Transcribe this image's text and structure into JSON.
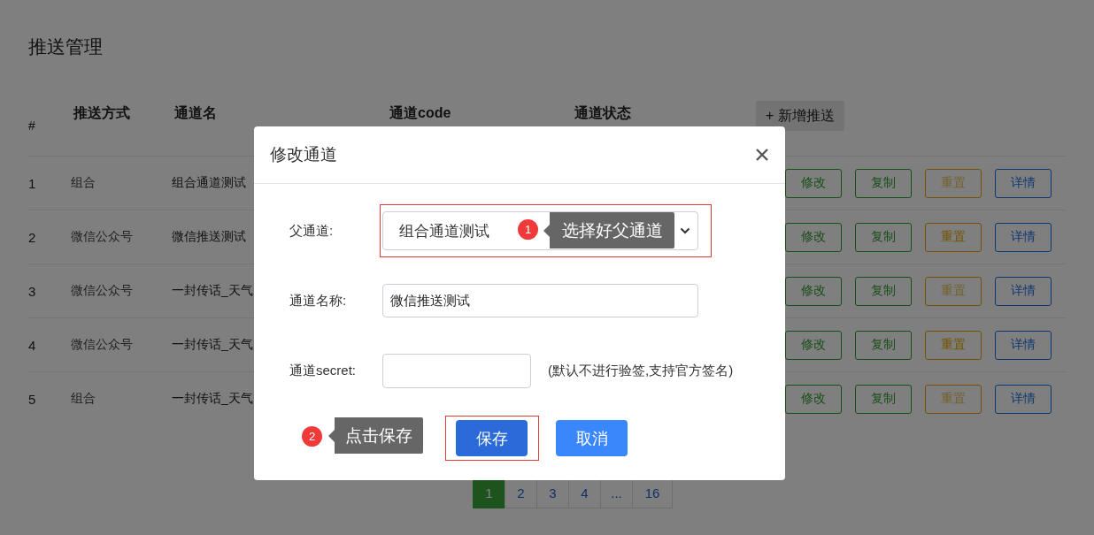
{
  "page": {
    "title": "推送管理"
  },
  "table": {
    "columns": [
      "#",
      "推送方式",
      "通道名",
      "通道code",
      "通道状态"
    ],
    "add_button": "+ 新增推送",
    "rows": [
      {
        "index": "1",
        "type": "组合",
        "name": "组合通道测试",
        "actions": [
          {
            "label": "修改",
            "kind": "edit"
          },
          {
            "label": "复制",
            "kind": "copy"
          },
          {
            "label": "重置",
            "kind": "reset",
            "disabled": true
          },
          {
            "label": "详情",
            "kind": "detail"
          }
        ]
      },
      {
        "index": "2",
        "type": "微信公众号",
        "name": "微信推送测试",
        "actions": [
          {
            "label": "修改",
            "kind": "edit"
          },
          {
            "label": "复制",
            "kind": "copy"
          },
          {
            "label": "重置",
            "kind": "reset",
            "disabled": false
          },
          {
            "label": "详情",
            "kind": "detail"
          }
        ]
      },
      {
        "index": "3",
        "type": "微信公众号",
        "name": "一封传话_天气",
        "actions": [
          {
            "label": "修改",
            "kind": "edit"
          },
          {
            "label": "复制",
            "kind": "copy"
          },
          {
            "label": "重置",
            "kind": "reset",
            "disabled": true
          },
          {
            "label": "详情",
            "kind": "detail"
          }
        ]
      },
      {
        "index": "4",
        "type": "微信公众号",
        "name": "一封传话_天气",
        "actions": [
          {
            "label": "修改",
            "kind": "edit"
          },
          {
            "label": "复制",
            "kind": "copy"
          },
          {
            "label": "重置",
            "kind": "reset",
            "disabled": false
          },
          {
            "label": "详情",
            "kind": "detail"
          }
        ]
      },
      {
        "index": "5",
        "type": "组合",
        "name": "一封传话_天气",
        "actions": [
          {
            "label": "修改",
            "kind": "edit"
          },
          {
            "label": "复制",
            "kind": "copy"
          },
          {
            "label": "重置",
            "kind": "reset",
            "disabled": true
          },
          {
            "label": "详情",
            "kind": "detail"
          }
        ]
      }
    ]
  },
  "pagination": [
    {
      "label": "1",
      "selected": true
    },
    {
      "label": "2",
      "selected": false
    },
    {
      "label": "3",
      "selected": false
    },
    {
      "label": "4",
      "selected": false
    },
    {
      "label": "...",
      "selected": false
    },
    {
      "label": "16",
      "selected": false
    }
  ],
  "dialog": {
    "title": "修改通道",
    "fields": [
      {
        "kind": "select",
        "label": "父通道:",
        "value": "组合通道测试"
      },
      {
        "kind": "text",
        "label": "通道名称:",
        "value": "微信推送测试"
      },
      {
        "kind": "short",
        "label": "通道secret:",
        "hint": "(默认不进行验签,支持官方签名)"
      }
    ],
    "buttons": [
      {
        "label": "保存",
        "kind": "primary"
      },
      {
        "label": "取消",
        "kind": "secondary"
      }
    ]
  },
  "annotations": [
    {
      "number": "1",
      "text": "选择好父通道"
    },
    {
      "number": "2",
      "text": "点击保存"
    }
  ]
}
